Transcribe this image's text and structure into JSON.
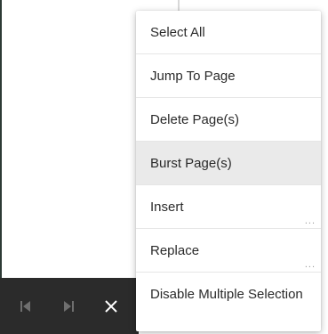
{
  "context_menu": {
    "items": [
      {
        "label": "Select All",
        "highlighted": false,
        "has_submenu": false
      },
      {
        "label": "Jump To Page",
        "highlighted": false,
        "has_submenu": false
      },
      {
        "label": "Delete Page(s)",
        "highlighted": false,
        "has_submenu": false
      },
      {
        "label": "Burst Page(s)",
        "highlighted": true,
        "has_submenu": false
      },
      {
        "label": "Insert",
        "highlighted": false,
        "has_submenu": true,
        "submenu_hint": "..."
      },
      {
        "label": "Replace",
        "highlighted": false,
        "has_submenu": true,
        "submenu_hint": "..."
      },
      {
        "label": "Disable Multiple Selection",
        "highlighted": false,
        "has_submenu": false
      }
    ]
  },
  "toolbar": {
    "icons": [
      "first-page-icon",
      "last-page-icon",
      "close-icon"
    ]
  },
  "colors": {
    "toolbar_bg": "#2b2b2b",
    "icon_dim": "#6f6f6f",
    "icon_bright": "#ffffff",
    "menu_highlight": "#eaeaea",
    "text": "#2a2a2a"
  }
}
